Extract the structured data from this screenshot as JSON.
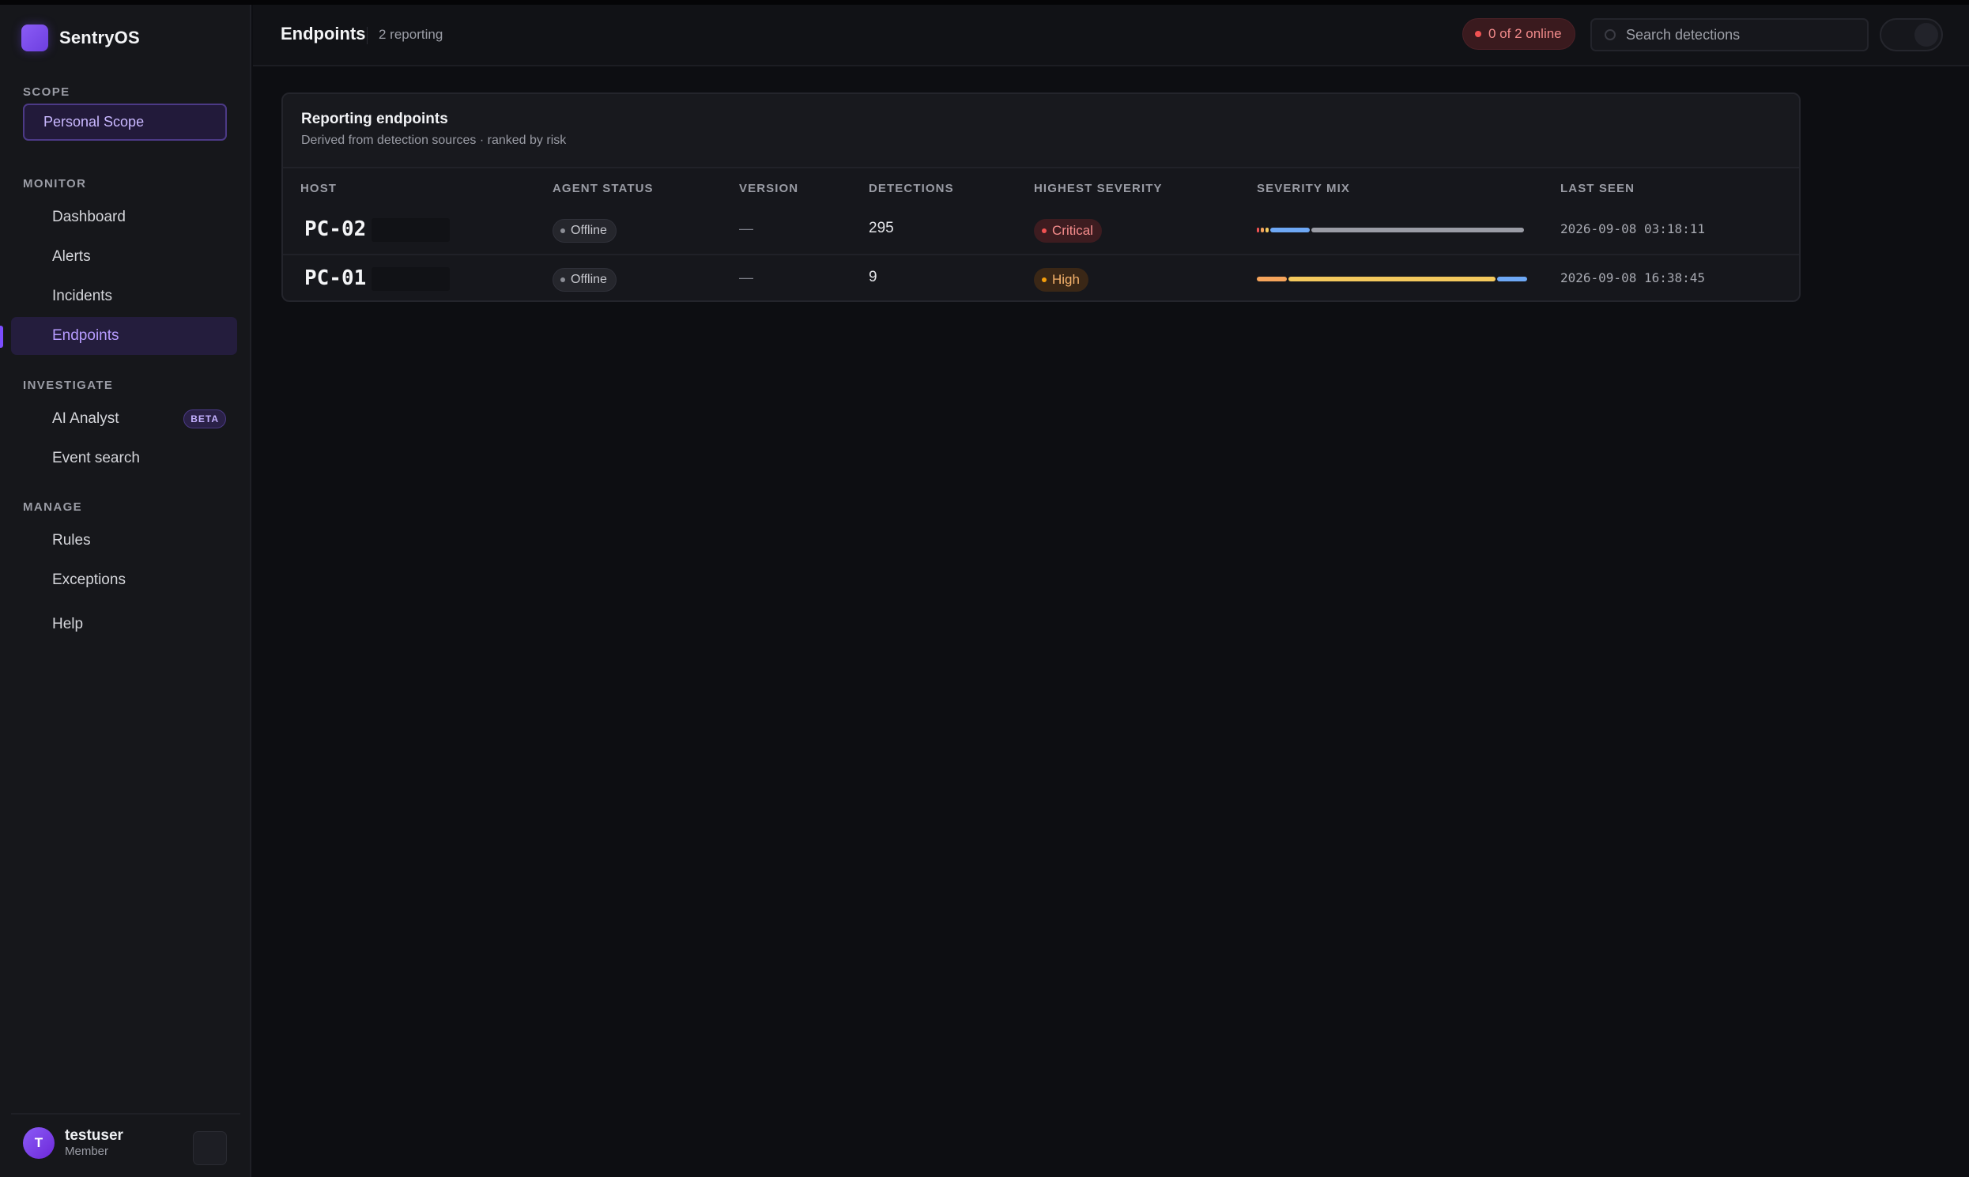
{
  "brand": {
    "name": "SentryOS"
  },
  "sidebar": {
    "scope_label": "SCOPE",
    "scope_value": "Personal Scope",
    "sections": [
      {
        "label": "MONITOR",
        "items": [
          "Dashboard",
          "Alerts",
          "Incidents",
          "Endpoints"
        ]
      },
      {
        "label": "INVESTIGATE",
        "items": [
          "AI Analyst",
          "Event search"
        ]
      },
      {
        "label": "MANAGE",
        "items": [
          "Rules",
          "Exceptions"
        ]
      }
    ],
    "help": "Help",
    "beta_badge": "BETA",
    "active_item": "Endpoints"
  },
  "user": {
    "initial": "T",
    "name": "testuser",
    "role": "Member"
  },
  "header": {
    "title": "Endpoints",
    "subtitle": "2 reporting",
    "online_status": "0 of 2 online",
    "search_placeholder": "Search detections"
  },
  "card": {
    "title": "Reporting endpoints",
    "subtitle": "Derived from detection sources · ranked by risk",
    "columns": [
      "HOST",
      "AGENT STATUS",
      "VERSION",
      "DETECTIONS",
      "HIGHEST SEVERITY",
      "SEVERITY MIX",
      "LAST SEEN"
    ],
    "rows": [
      {
        "host": "PC-02",
        "agent_status": "Offline",
        "version": "—",
        "detections": "295",
        "highest_severity": "Critical",
        "severity_mix": [
          {
            "level": "critical",
            "share": 0.01,
            "color": "#f05252"
          },
          {
            "level": "high",
            "share": 0.012,
            "color": "#f5a45b"
          },
          {
            "level": "medium",
            "share": 0.012,
            "color": "#f4c95d"
          },
          {
            "level": "low",
            "share": 0.15,
            "color": "#6ea8f5"
          },
          {
            "level": "info",
            "share": 0.806,
            "color": "#9a9ca5"
          }
        ],
        "last_seen": "2026-09-08 03:18:11"
      },
      {
        "host": "PC-01",
        "agent_status": "Offline",
        "version": "—",
        "detections": "9",
        "highest_severity": "High",
        "severity_mix": [
          {
            "level": "high",
            "share": 0.111,
            "color": "#f5a45b"
          },
          {
            "level": "medium",
            "share": 0.778,
            "color": "#f4c95d"
          },
          {
            "level": "low",
            "share": 0.111,
            "color": "#6ea8f5"
          }
        ],
        "last_seen": "2026-09-08 16:38:45"
      }
    ]
  }
}
